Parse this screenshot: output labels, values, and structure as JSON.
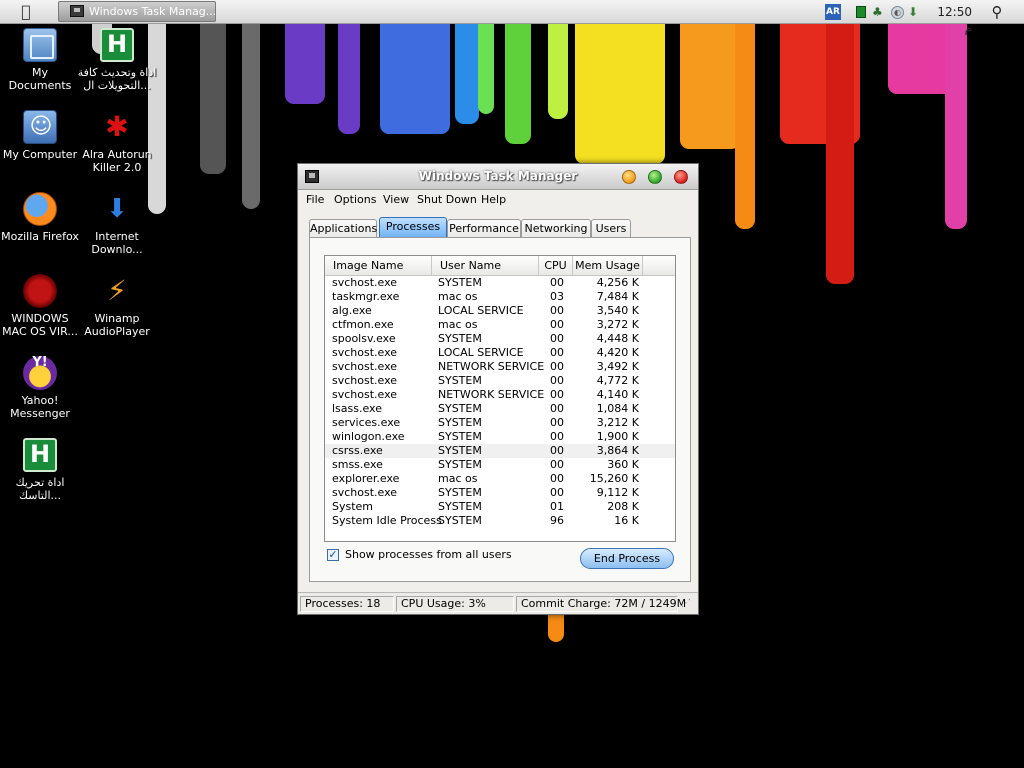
{
  "topbar": {
    "app_menu_icon": "apple-logo-icon",
    "task_button_label": "Windows Task Manag...",
    "tray": {
      "language": "AR",
      "clock": "12:50 م"
    },
    "search_icon": "search-icon"
  },
  "desktop": {
    "icons": [
      {
        "label": "My Documents",
        "icon": "folder-icon"
      },
      {
        "label": "اداة وتحديث كافة التحويلات ال...",
        "icon": "h-green-icon"
      },
      {
        "label": "My Computer",
        "icon": "finder-icon"
      },
      {
        "label": "Alra Autorun Killer 2.0",
        "icon": "bug-icon"
      },
      {
        "label": "Mozilla Firefox",
        "icon": "firefox-icon"
      },
      {
        "label": "Internet Downlo...",
        "icon": "idm-icon"
      },
      {
        "label": "WINDOWS MAC OS VIR...",
        "icon": "virus-icon"
      },
      {
        "label": "Winamp AudioPlayer",
        "icon": "winamp-icon"
      },
      {
        "label": "Yahoo! Messenger",
        "icon": "yahoo-icon"
      },
      {
        "label": "اداة تحريك التاسك...",
        "icon": "h-green-icon"
      }
    ]
  },
  "window": {
    "title": "Windows Task Manager",
    "menu": [
      "File",
      "Options",
      "View",
      "Shut Down",
      "Help"
    ],
    "tabs": [
      "Applications",
      "Processes",
      "Performance",
      "Networking",
      "Users"
    ],
    "active_tab": "Processes",
    "columns": [
      "Image Name",
      "User Name",
      "CPU",
      "Mem Usage"
    ],
    "processes": [
      {
        "name": "svchost.exe",
        "user": "SYSTEM",
        "cpu": "00",
        "mem": "4,256 K"
      },
      {
        "name": "taskmgr.exe",
        "user": "mac os",
        "cpu": "03",
        "mem": "7,484 K"
      },
      {
        "name": "alg.exe",
        "user": "LOCAL SERVICE",
        "cpu": "00",
        "mem": "3,540 K"
      },
      {
        "name": "ctfmon.exe",
        "user": "mac os",
        "cpu": "00",
        "mem": "3,272 K"
      },
      {
        "name": "spoolsv.exe",
        "user": "SYSTEM",
        "cpu": "00",
        "mem": "4,448 K"
      },
      {
        "name": "svchost.exe",
        "user": "LOCAL SERVICE",
        "cpu": "00",
        "mem": "4,420 K"
      },
      {
        "name": "svchost.exe",
        "user": "NETWORK SERVICE",
        "cpu": "00",
        "mem": "3,492 K"
      },
      {
        "name": "svchost.exe",
        "user": "SYSTEM",
        "cpu": "00",
        "mem": "4,772 K"
      },
      {
        "name": "svchost.exe",
        "user": "NETWORK SERVICE",
        "cpu": "00",
        "mem": "4,140 K"
      },
      {
        "name": "lsass.exe",
        "user": "SYSTEM",
        "cpu": "00",
        "mem": "1,084 K"
      },
      {
        "name": "services.exe",
        "user": "SYSTEM",
        "cpu": "00",
        "mem": "3,212 K"
      },
      {
        "name": "winlogon.exe",
        "user": "SYSTEM",
        "cpu": "00",
        "mem": "1,900 K"
      },
      {
        "name": "csrss.exe",
        "user": "SYSTEM",
        "cpu": "00",
        "mem": "3,864 K"
      },
      {
        "name": "smss.exe",
        "user": "SYSTEM",
        "cpu": "00",
        "mem": "360 K"
      },
      {
        "name": "explorer.exe",
        "user": "mac os",
        "cpu": "00",
        "mem": "15,260 K"
      },
      {
        "name": "svchost.exe",
        "user": "SYSTEM",
        "cpu": "00",
        "mem": "9,112 K"
      },
      {
        "name": "System",
        "user": "SYSTEM",
        "cpu": "01",
        "mem": "208 K"
      },
      {
        "name": "System Idle Process",
        "user": "SYSTEM",
        "cpu": "96",
        "mem": "16 K"
      }
    ],
    "selected_row": 12,
    "show_all_label": "Show processes from all users",
    "show_all_checked": true,
    "end_process_label": "End Process",
    "status": {
      "processes": "Processes: 18",
      "cpu": "CPU Usage: 3%",
      "commit": "Commit Charge: 72M / 1249M"
    }
  }
}
